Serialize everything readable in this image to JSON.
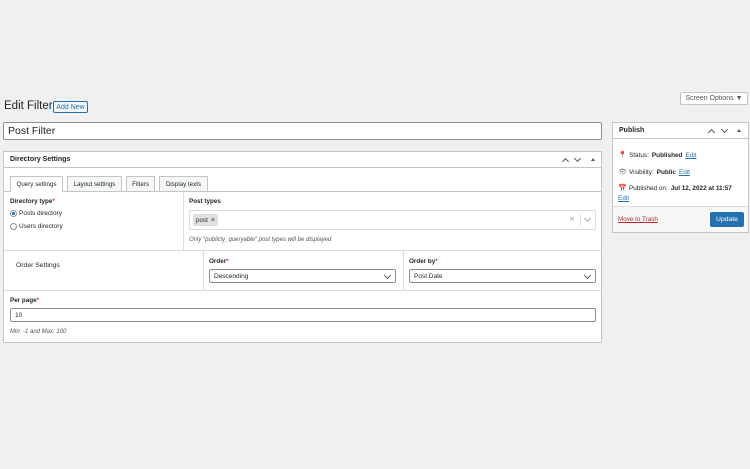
{
  "screen_options": {
    "label": "Screen Options ▼"
  },
  "page": {
    "title": "Edit Filter",
    "add_new": "Add New"
  },
  "title_field": {
    "value": "Post Filter"
  },
  "directory_settings": {
    "title": "Directory Settings",
    "tabs": [
      {
        "label": "Query settings",
        "active": true
      },
      {
        "label": "Layout settings",
        "active": false
      },
      {
        "label": "Filters",
        "active": false
      },
      {
        "label": "Display texts",
        "active": false
      }
    ],
    "directory_type": {
      "label": "Directory type",
      "options": [
        {
          "label": "Posts directory",
          "selected": true
        },
        {
          "label": "Users directory",
          "selected": false
        }
      ]
    },
    "post_types": {
      "label": "Post types",
      "tag": "post",
      "tag_remove": "×",
      "clear": "×",
      "hint": "Only \"publicly_queryable\" post types will be displayed"
    },
    "order_settings": {
      "label": "Order Settings",
      "order": {
        "label": "Order",
        "value": "Descending"
      },
      "order_by": {
        "label": "Order by",
        "value": "Post Date"
      }
    },
    "per_page": {
      "label": "Per page",
      "value": "10",
      "hint": "Min: -1 and Max: 100"
    },
    "required_mark": "*"
  },
  "publish": {
    "title": "Publish",
    "status_label": "Status:",
    "status_value": "Published",
    "visibility_label": "Visibility:",
    "visibility_value": "Public",
    "published_label": "Published on:",
    "published_value": "Jul 12, 2022 at 11:57",
    "edit": "Edit",
    "trash": "Move to Trash",
    "update": "Update"
  },
  "colors": {
    "accent": "#2271b1",
    "danger": "#b32d2e"
  }
}
